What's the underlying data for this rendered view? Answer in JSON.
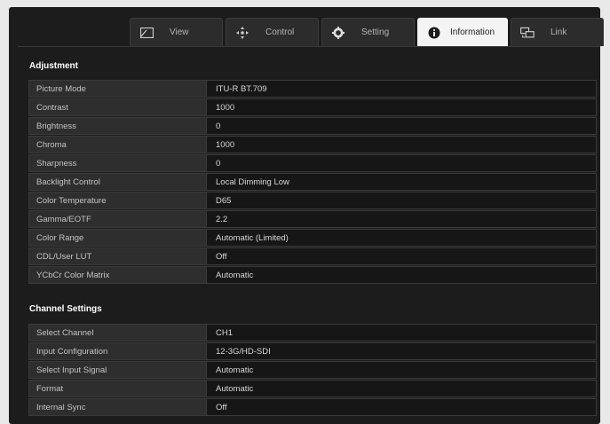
{
  "tabs": [
    {
      "label": "View",
      "icon": "view-icon",
      "active": false
    },
    {
      "label": "Control",
      "icon": "control-icon",
      "active": false
    },
    {
      "label": "Setting",
      "icon": "gear-icon",
      "active": false
    },
    {
      "label": "Information",
      "icon": "info-icon",
      "active": true
    },
    {
      "label": "Link",
      "icon": "link-icon",
      "active": false
    }
  ],
  "adjustment": {
    "title": "Adjustment",
    "rows": [
      {
        "label": "Picture Mode",
        "value": "ITU-R BT.709"
      },
      {
        "label": "Contrast",
        "value": "1000"
      },
      {
        "label": "Brightness",
        "value": "0"
      },
      {
        "label": "Chroma",
        "value": "1000"
      },
      {
        "label": "Sharpness",
        "value": "0"
      },
      {
        "label": "Backlight Control",
        "value": "Local Dimming Low"
      },
      {
        "label": "Color Temperature",
        "value": "D65"
      },
      {
        "label": "Gamma/EOTF",
        "value": "2.2"
      },
      {
        "label": "Color Range",
        "value": "Automatic (Limited)"
      },
      {
        "label": "CDL/User LUT",
        "value": "Off"
      },
      {
        "label": "YCbCr Color Matrix",
        "value": "Automatic"
      }
    ]
  },
  "channel_settings": {
    "title": "Channel Settings",
    "rows": [
      {
        "label": "Select Channel",
        "value": "CH1"
      },
      {
        "label": "Input Configuration",
        "value": "12-3G/HD-SDI"
      },
      {
        "label": "Select Input Signal",
        "value": "Automatic"
      },
      {
        "label": "Format",
        "value": "Automatic"
      },
      {
        "label": "Internal Sync",
        "value": "Off"
      }
    ]
  },
  "colors": {
    "background": "#1c1c1c",
    "active_tab": "#f4f4f4",
    "label_cell": "#2e2e2e",
    "value_cell": "#161616"
  }
}
